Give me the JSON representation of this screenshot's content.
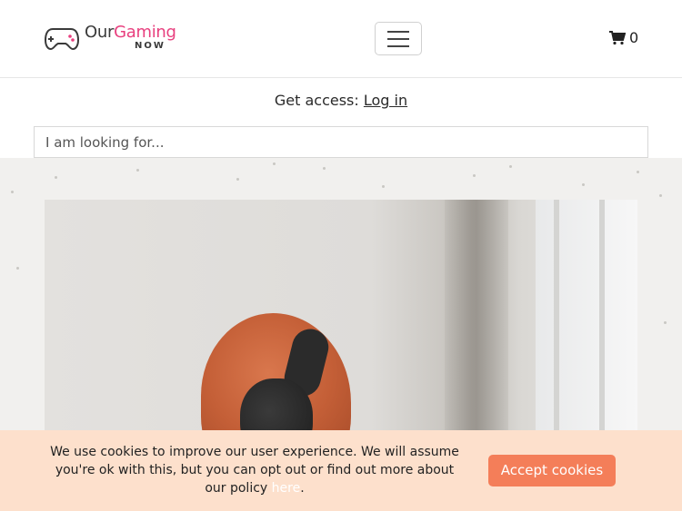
{
  "header": {
    "logo": {
      "our": "Our",
      "gaming": "Gaming",
      "now": "NOW"
    },
    "menu_toggle_icon": "hamburger-icon",
    "cart": {
      "icon": "cart-icon",
      "count": "0"
    }
  },
  "access": {
    "prefix": "Get access:",
    "login_label": "Log in"
  },
  "search": {
    "placeholder": "I am looking for..."
  },
  "hero": {
    "image": "person-with-headphones"
  },
  "cookie": {
    "message_before": "We use cookies to improve our user experience. We will assume you're ok with this, but you can opt out or find out more about our policy ",
    "link_label": "here",
    "message_after": ".",
    "accept_label": "Accept cookies"
  },
  "colors": {
    "brand_pink": "#e83f7e",
    "accent_orange": "#f47e59",
    "cookie_bg": "#fde0cc"
  }
}
